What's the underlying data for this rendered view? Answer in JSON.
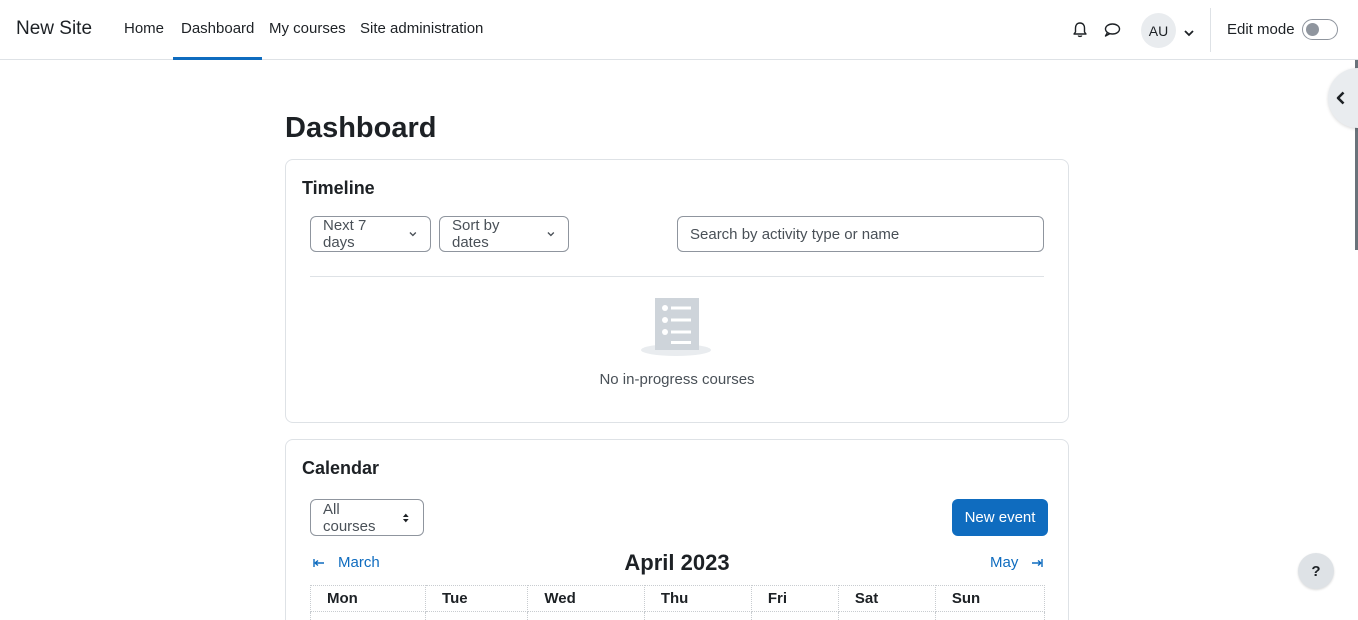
{
  "navbar": {
    "brand": "New Site",
    "links": [
      {
        "label": "Home"
      },
      {
        "label": "Dashboard",
        "active": true
      },
      {
        "label": "My courses"
      },
      {
        "label": "Site administration"
      }
    ],
    "icons": [
      "bell-icon",
      "chat-bubble-icon"
    ],
    "avatar_initials": "AU",
    "edit_mode_label": "Edit mode",
    "edit_mode_on": false
  },
  "page": {
    "title": "Dashboard"
  },
  "timeline": {
    "title": "Timeline",
    "filter_label": "Next 7 days",
    "sort_label": "Sort by dates",
    "search_placeholder": "Search by activity type or name",
    "empty_message": "No in-progress courses"
  },
  "calendar": {
    "title": "Calendar",
    "course_filter": "All courses",
    "new_event_label": "New event",
    "prev_month": "March",
    "current_month": "April 2023",
    "next_month": "May",
    "weekdays": [
      "Mon",
      "Tue",
      "Wed",
      "Thu",
      "Fri",
      "Sat",
      "Sun"
    ]
  },
  "help_label": "?",
  "colors": {
    "accent": "#0f6cbf",
    "border": "#dee2e6",
    "text": "#1d2125",
    "muted": "#495057"
  }
}
